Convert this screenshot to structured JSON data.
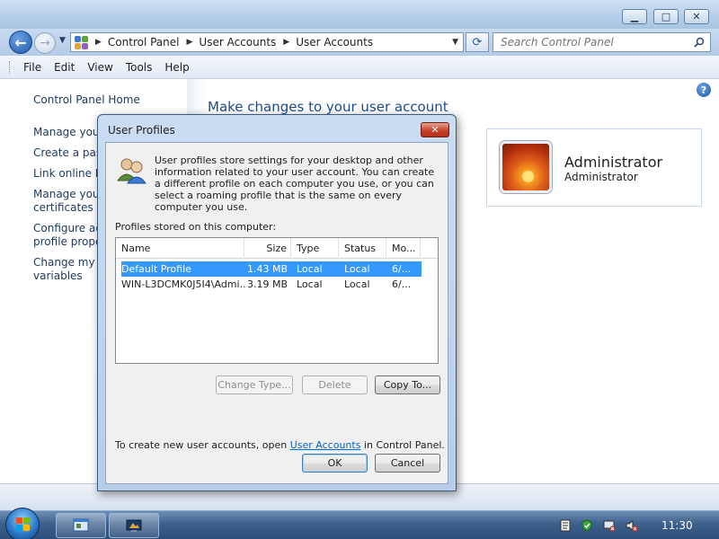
{
  "window": {
    "minimize_glyph": "▁",
    "maximize_glyph": "□",
    "close_glyph": "✕"
  },
  "nav": {
    "back_glyph": "←",
    "forward_glyph": "→",
    "recent_glyph": "▼",
    "breadcrumbs": [
      "Control Panel",
      "User Accounts",
      "User Accounts"
    ],
    "breadcrumb_separator": "▶",
    "address_dropdown_glyph": "▼",
    "refresh_glyph": "⟳",
    "search_placeholder": "Search Control Panel"
  },
  "menu": {
    "items": [
      "File",
      "Edit",
      "View",
      "Tools",
      "Help"
    ]
  },
  "sidebar": {
    "home": "Control Panel Home",
    "links": [
      "Manage your",
      "Create a passw",
      "Link online ID",
      "Manage your",
      "certificates",
      "Configure adv",
      "profile proper",
      "Change my e",
      "variables"
    ]
  },
  "content": {
    "heading": "Make changes to your user account",
    "help_glyph": "?",
    "user_name": "Administrator",
    "user_role": "Administrator"
  },
  "dialog": {
    "title": "User Profiles",
    "close_glyph": "✕",
    "description": "User profiles store settings for your desktop and other information related to your user account. You can create a different profile on each computer you use, or you can select a roaming profile that is the same on every computer you use.",
    "list_label": "Profiles stored on this computer:",
    "columns": [
      "Name",
      "Size",
      "Type",
      "Status",
      "Mo..."
    ],
    "rows": [
      {
        "name": "Default Profile",
        "size": "1.43 MB",
        "type": "Local",
        "status": "Local",
        "modified": "6/..."
      },
      {
        "name": "WIN-L3DCMK0J5I4\\Admi...",
        "size": "3.19 MB",
        "type": "Local",
        "status": "Local",
        "modified": "6/..."
      }
    ],
    "buttons": {
      "change_type": "Change Type...",
      "delete": "Delete",
      "copy_to": "Copy To...",
      "ok": "OK",
      "cancel": "Cancel"
    },
    "note_prefix": "To create new user accounts, open ",
    "note_link": "User Accounts",
    "note_suffix": " in Control Panel."
  },
  "taskbar": {
    "clock": "11:30"
  },
  "colors": {
    "selection": "#3399ff",
    "link": "#1e395b",
    "heading": "#1e4c8e",
    "taskbar": "#3e618c"
  }
}
